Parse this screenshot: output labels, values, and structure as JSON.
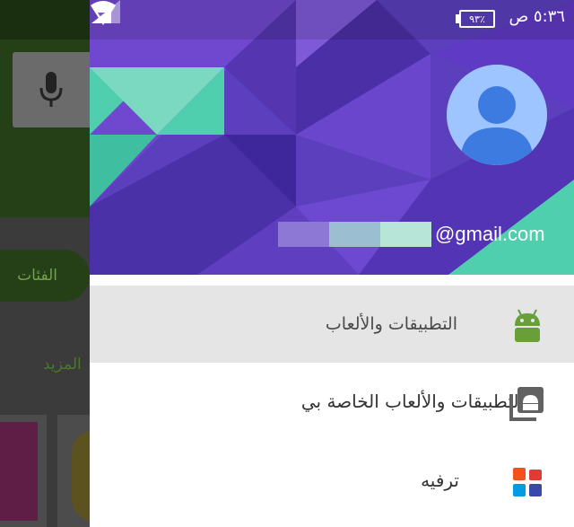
{
  "status_bar": {
    "time": "٥:٣٦ ص",
    "battery": "٩٣٪"
  },
  "background_app": {
    "categories_label": "الفئات",
    "more_label": "المزيد",
    "mic_icon": "mic-icon"
  },
  "account": {
    "email_domain": "@gmail.com",
    "avatar_icon": "person-icon"
  },
  "nav": {
    "items": [
      {
        "label": "التطبيقات والألعاب",
        "icon": "android-icon",
        "active": true
      },
      {
        "label": "التطبيقات والألعاب الخاصة بي",
        "icon": "library-icon",
        "active": false
      },
      {
        "label": "ترفيه",
        "icon": "entertainment-icon",
        "active": false
      }
    ]
  },
  "colors": {
    "header_purple": "#6a3fc4",
    "header_teal": "#4fcfae",
    "android_green": "#689f38",
    "avatar_blue": "#9ec5ff"
  }
}
